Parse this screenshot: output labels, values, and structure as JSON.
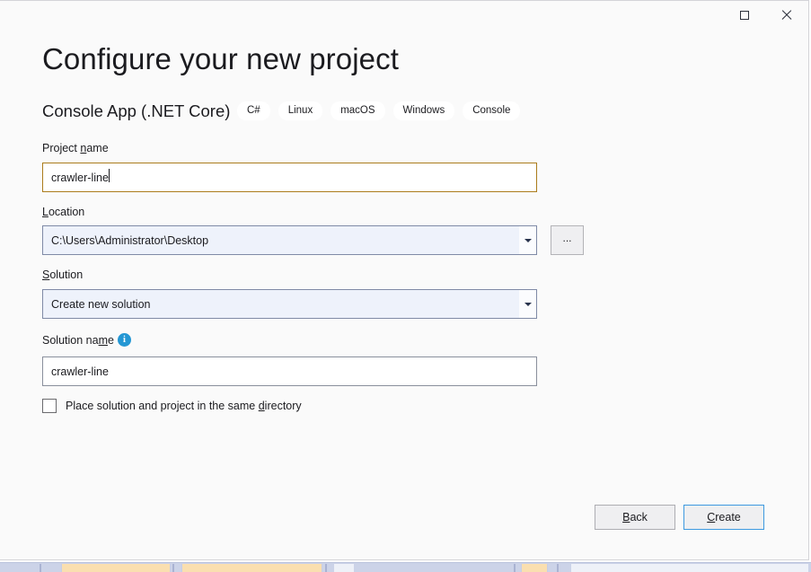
{
  "window": {
    "controls": {
      "maximize_label": "Maximize",
      "maximize_icon": "square-icon",
      "close_label": "Close",
      "close_icon": "close-icon"
    }
  },
  "header": {
    "title": "Configure your new project",
    "template_name": "Console App (.NET Core)",
    "tags": [
      "C#",
      "Linux",
      "macOS",
      "Windows",
      "Console"
    ]
  },
  "form": {
    "project_name": {
      "label_before": "Project ",
      "label_accel": "n",
      "label_after": "ame",
      "value": "crawler-line",
      "placeholder": ""
    },
    "location": {
      "label_accel": "L",
      "label_after": "ocation",
      "value": "C:\\Users\\Administrator\\Desktop",
      "browse_label": "...",
      "dropdown_icon": "chevron-down-icon"
    },
    "solution": {
      "label_accel": "S",
      "label_after": "olution",
      "value": "Create new solution",
      "dropdown_icon": "chevron-down-icon"
    },
    "solution_name": {
      "label_before": "Solution na",
      "label_accel": "m",
      "label_after": "e",
      "value": "crawler-line",
      "info_icon": "info-icon",
      "info_glyph": "i"
    },
    "same_directory": {
      "label_before": "Place solution and project in the same ",
      "label_accel": "d",
      "label_after": "irectory",
      "checked": false
    }
  },
  "footer": {
    "back_accel": "B",
    "back_after": "ack",
    "create_accel": "C",
    "create_after": "reate"
  },
  "colors": {
    "dialog_background": "#fafafa",
    "focused_input_border": "#ab7c1b",
    "combo_background": "#eef2fb",
    "info_icon_blue": "#2497d4",
    "default_button_border": "#3d99e0",
    "text": "#1b1b1f"
  }
}
